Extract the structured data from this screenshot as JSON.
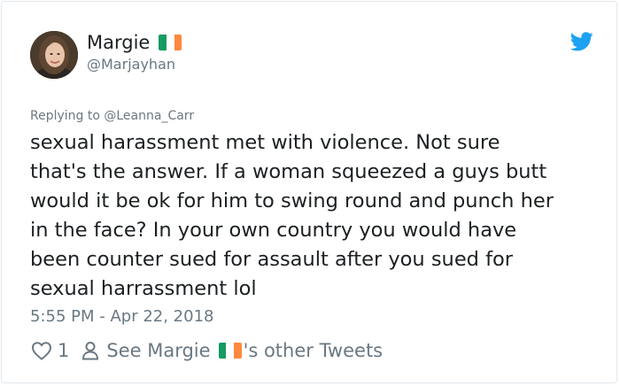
{
  "author": {
    "name": "Margie",
    "handle": "@Marjayhan",
    "flag_colors": [
      "#169b62",
      "#ffffff",
      "#ff883e"
    ]
  },
  "reply_to": "Replying to @Leanna_Carr",
  "tweet_text": "sexual harassment met with violence. Not sure\nthat's the answer. If a woman squeezed a guys butt\nwould it be ok for him to swing round and punch her\nin the face? In your own country you would have\nbeen counter sued for assault after you sued for\nsexual harrassment lol",
  "timestamp": "5:55 PM - Apr 22, 2018",
  "actions": {
    "like_count": "1",
    "see_prefix": "See Margie",
    "see_suffix": "'s other Tweets"
  },
  "icons": {
    "bird": "twitter-bird-icon",
    "heart": "heart-icon",
    "person": "person-icon"
  },
  "colors": {
    "twitter_blue": "#1da1f2",
    "text": "#1c2022",
    "muted": "#697882"
  }
}
